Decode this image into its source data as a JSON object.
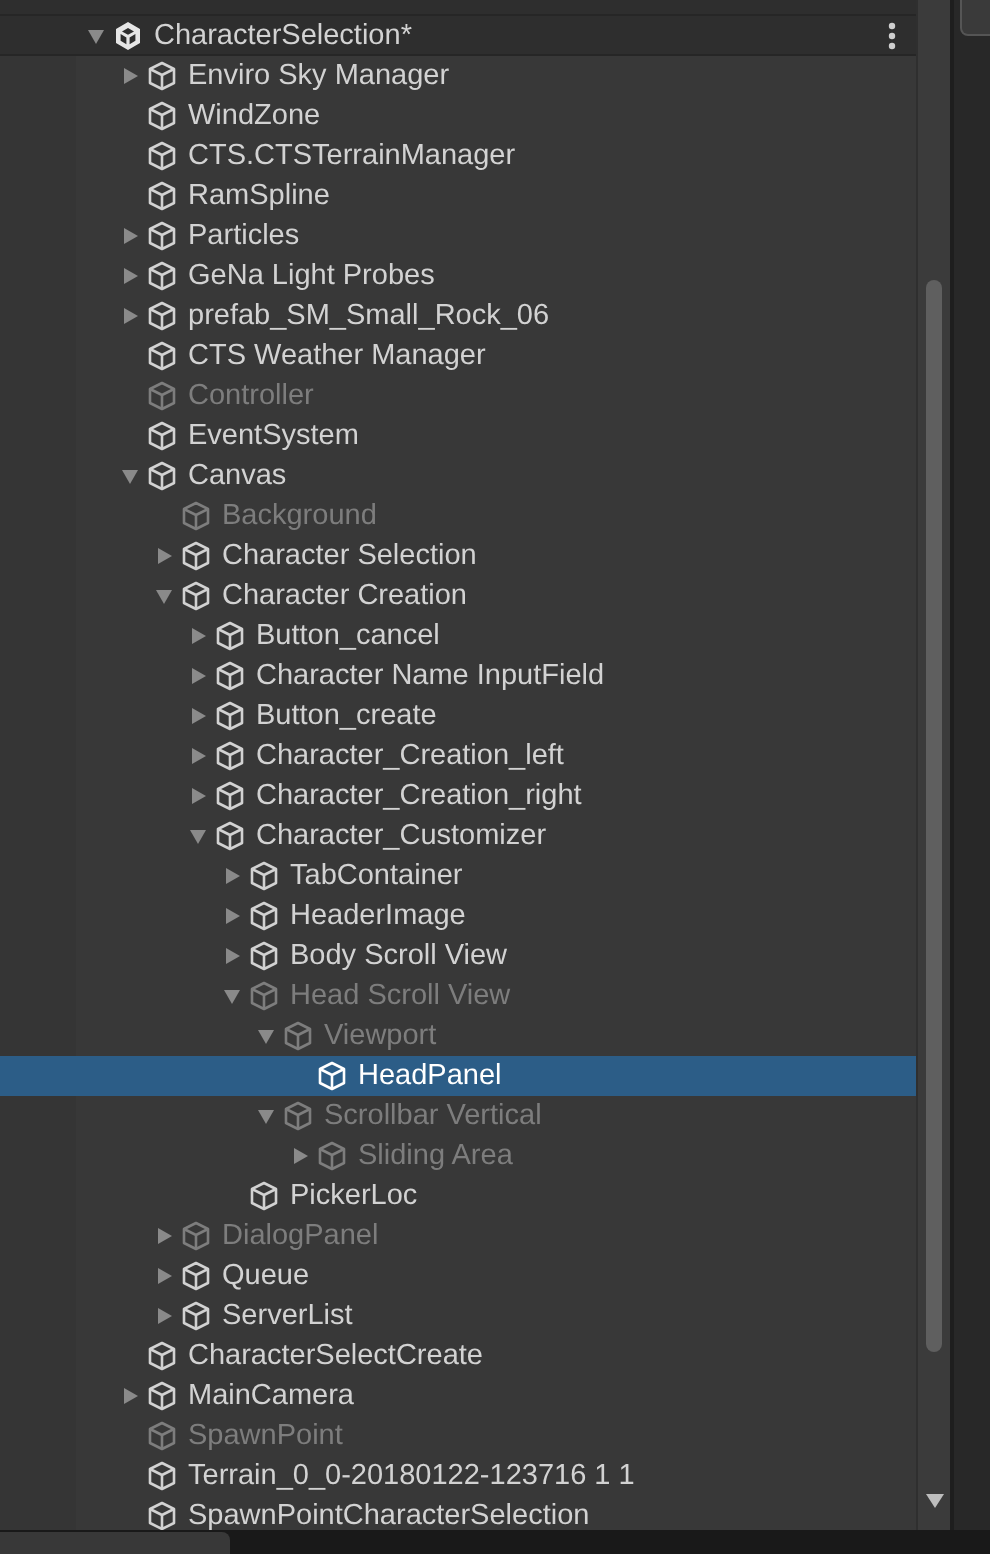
{
  "hierarchy": {
    "scenes": [
      {
        "name": "CharacterSelection*",
        "disabled": false,
        "selected": false,
        "expanded": true,
        "children": [
          {
            "name": "Enviro Sky Manager",
            "disabled": false,
            "selected": false,
            "expanded": false
          },
          {
            "name": "WindZone",
            "disabled": false,
            "selected": false
          },
          {
            "name": "CTS.CTSTerrainManager",
            "disabled": false,
            "selected": false
          },
          {
            "name": "RamSpline",
            "disabled": false,
            "selected": false
          },
          {
            "name": "Particles",
            "disabled": false,
            "selected": false,
            "expanded": false
          },
          {
            "name": "GeNa Light Probes",
            "disabled": false,
            "selected": false,
            "expanded": false
          },
          {
            "name": "prefab_SM_Small_Rock_06",
            "disabled": false,
            "selected": false,
            "expanded": false
          },
          {
            "name": "CTS Weather Manager",
            "disabled": false,
            "selected": false
          },
          {
            "name": "Controller",
            "disabled": true,
            "selected": false
          },
          {
            "name": "EventSystem",
            "disabled": false,
            "selected": false
          },
          {
            "name": "Canvas",
            "disabled": false,
            "selected": false,
            "expanded": true,
            "children": [
              {
                "name": "Background",
                "disabled": true,
                "selected": false
              },
              {
                "name": "Character Selection",
                "disabled": false,
                "selected": false,
                "expanded": false
              },
              {
                "name": "Character Creation",
                "disabled": false,
                "selected": false,
                "expanded": true,
                "children": [
                  {
                    "name": "Button_cancel",
                    "disabled": false,
                    "selected": false,
                    "expanded": false
                  },
                  {
                    "name": "Character Name InputField",
                    "disabled": false,
                    "selected": false,
                    "expanded": false
                  },
                  {
                    "name": "Button_create",
                    "disabled": false,
                    "selected": false,
                    "expanded": false
                  },
                  {
                    "name": "Character_Creation_left",
                    "disabled": false,
                    "selected": false,
                    "expanded": false
                  },
                  {
                    "name": "Character_Creation_right",
                    "disabled": false,
                    "selected": false,
                    "expanded": false
                  },
                  {
                    "name": "Character_Customizer",
                    "disabled": false,
                    "selected": false,
                    "expanded": true,
                    "children": [
                      {
                        "name": "TabContainer",
                        "disabled": false,
                        "selected": false,
                        "expanded": false
                      },
                      {
                        "name": "HeaderImage",
                        "disabled": false,
                        "selected": false,
                        "expanded": false
                      },
                      {
                        "name": "Body Scroll View",
                        "disabled": false,
                        "selected": false,
                        "expanded": false
                      },
                      {
                        "name": "Head Scroll View",
                        "disabled": true,
                        "selected": false,
                        "expanded": true,
                        "children": [
                          {
                            "name": "Viewport",
                            "disabled": true,
                            "selected": false,
                            "expanded": true,
                            "children": [
                              {
                                "name": "HeadPanel",
                                "disabled": false,
                                "selected": true
                              }
                            ]
                          },
                          {
                            "name": "Scrollbar Vertical",
                            "disabled": true,
                            "selected": false,
                            "expanded": true,
                            "children": [
                              {
                                "name": "Sliding Area",
                                "disabled": true,
                                "selected": false,
                                "expanded": false
                              }
                            ]
                          }
                        ]
                      },
                      {
                        "name": "PickerLoc",
                        "disabled": false,
                        "selected": false
                      }
                    ]
                  }
                ]
              },
              {
                "name": "DialogPanel",
                "disabled": true,
                "selected": false,
                "expanded": false
              },
              {
                "name": "Queue",
                "disabled": false,
                "selected": false,
                "expanded": false
              },
              {
                "name": "ServerList",
                "disabled": false,
                "selected": false,
                "expanded": false
              }
            ]
          },
          {
            "name": "CharacterSelectCreate",
            "disabled": false,
            "selected": false
          },
          {
            "name": "MainCamera",
            "disabled": false,
            "selected": false,
            "expanded": false
          },
          {
            "name": "SpawnPoint",
            "disabled": true,
            "selected": false
          },
          {
            "name": "Terrain_0_0-20180122-123716 1 1",
            "disabled": false,
            "selected": false
          },
          {
            "name": "SpawnPointCharacterSelection",
            "disabled": false,
            "selected": false
          }
        ]
      }
    ]
  }
}
